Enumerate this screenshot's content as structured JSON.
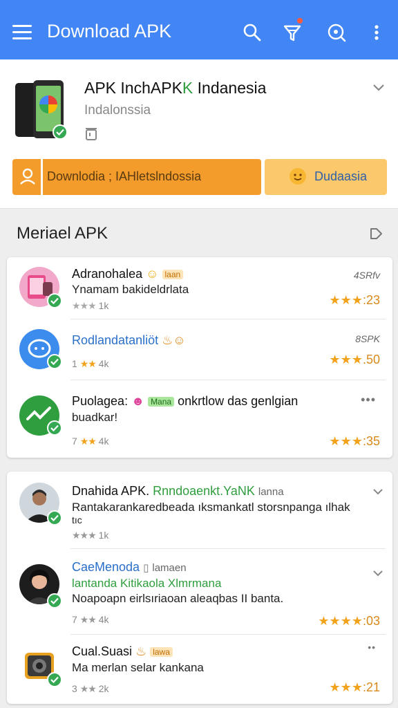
{
  "appbar": {
    "title": "Download APK",
    "icons": [
      "menu-icon",
      "search-icon",
      "filter-icon",
      "scan-search-icon",
      "more-vert-icon"
    ]
  },
  "header": {
    "app_title_a": "APK InchAPK",
    "app_title_b": "K",
    "app_title_c": " Indanesia",
    "subtitle": "Indalonssia",
    "download_button": "Downlodia ; IAHletslndossia",
    "alt_button": "Dudaasia"
  },
  "section": {
    "title": "Meriael APK"
  },
  "list_one": [
    {
      "name": "Adranohalea",
      "badge": "laan",
      "desc": "Ynamam bakideldrlata",
      "meta_stars": "★★★",
      "meta_count": "1k",
      "tag": "4SRfv",
      "rating_stars": "★★★",
      "rating": ":23"
    },
    {
      "name": "Rodlandatanliöt",
      "desc": "",
      "meta_prefix": "1",
      "meta_stars": "★★",
      "meta_count": "4k",
      "tag": "8SPK",
      "rating_stars": "★★★",
      "rating": ".50"
    },
    {
      "name_a": "Puolagea:",
      "badge": "Mana",
      "name_b": "onkrtlow das genlgian",
      "desc": "buadkar!",
      "meta_prefix": "7",
      "meta_stars": "★★",
      "meta_count": "4k",
      "rating_stars": "★★★",
      "rating": ":35"
    }
  ],
  "list_two": [
    {
      "name_a": "Dnahida APK.",
      "name_b": "Rnndoaenkt.YaNK",
      "name_c": "lanna",
      "desc_a": "Rantakarankaredbeada ıksmankatl storsnpanga ılhak",
      "desc_b": "tıc",
      "meta_stars": "★★★",
      "meta_count": "1k"
    },
    {
      "name": "CaeMenoda",
      "tag": "lamaen",
      "sub": "lantanda Kitikaola Xlmrmana",
      "desc": "Noapoapn eirlsıriaoan aleaqbas II banta.",
      "meta_prefix": "7",
      "meta_stars": "★★",
      "meta_count": "4k",
      "rating_stars": "★★★★",
      "rating": ":03"
    },
    {
      "name": "Cual.Suasi",
      "badge": "lawa",
      "desc": "Ma merlan selar kankana",
      "meta_prefix": "3",
      "meta_stars": "★★",
      "meta_count": "2k",
      "rating_stars": "★★★",
      "rating": ":21"
    }
  ],
  "colors": {
    "appbar": "#4285f4",
    "primary_button": "#f39c2b",
    "secondary_button": "#fbc86c",
    "star": "#f2a31b",
    "verified": "#34a853"
  }
}
